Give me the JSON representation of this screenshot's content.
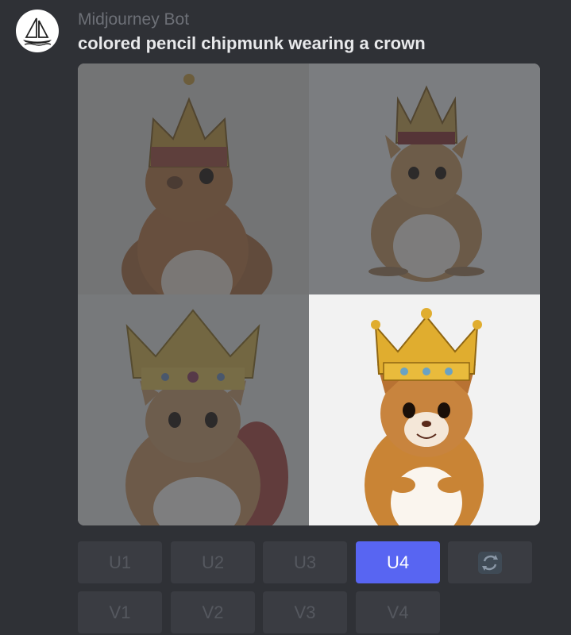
{
  "message": {
    "author": "Midjourney Bot",
    "prompt": "colored pencil chipmunk wearing a crown",
    "avatar_icon": "sailboat-icon"
  },
  "image_grid": {
    "selected_index": 4,
    "images": [
      {
        "index": 1,
        "state": "dimmed"
      },
      {
        "index": 2,
        "state": "dimmed"
      },
      {
        "index": 3,
        "state": "dimmed"
      },
      {
        "index": 4,
        "state": "selected"
      }
    ]
  },
  "buttons": {
    "upscale": [
      "U1",
      "U2",
      "U3",
      "U4"
    ],
    "variation": [
      "V1",
      "V2",
      "V3",
      "V4"
    ],
    "reroll_icon": "refresh-icon",
    "active": "U4"
  },
  "colors": {
    "background": "#2f3136",
    "button": "#3a3c42",
    "accent": "#5865f2"
  }
}
